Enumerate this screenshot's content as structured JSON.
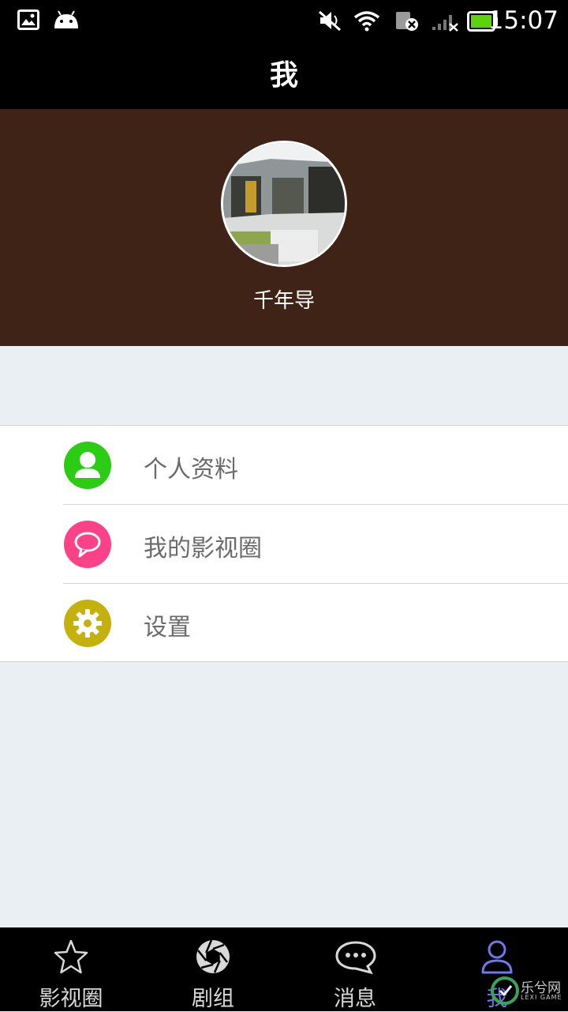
{
  "status_bar": {
    "time": "15:07",
    "icons": [
      "gallery-icon",
      "android-icon",
      "mute-icon",
      "wifi-icon",
      "sim-error-icon",
      "signal-icon",
      "battery-icon"
    ]
  },
  "header": {
    "title": "我"
  },
  "profile": {
    "username": "千年导"
  },
  "menu": {
    "items": [
      {
        "label": "个人资料",
        "icon": "person-icon",
        "color": "#2bcc13"
      },
      {
        "label": "我的影视圈",
        "icon": "chat-bubble-icon",
        "color": "#fb4187"
      },
      {
        "label": "设置",
        "icon": "gear-icon",
        "color": "#c4b10e"
      }
    ]
  },
  "tabs": [
    {
      "label": "影视圈",
      "icon": "star-icon",
      "active": false
    },
    {
      "label": "剧组",
      "icon": "aperture-icon",
      "active": false
    },
    {
      "label": "消息",
      "icon": "message-icon",
      "active": false
    },
    {
      "label": "我",
      "icon": "user-icon",
      "active": true
    }
  ],
  "colors": {
    "header_background": "#3e2316",
    "page_background": "#e9eff3",
    "active_tab": "#6d79e8"
  },
  "watermark": {
    "text": "乐兮网",
    "subtext": "LEXI GAME"
  }
}
